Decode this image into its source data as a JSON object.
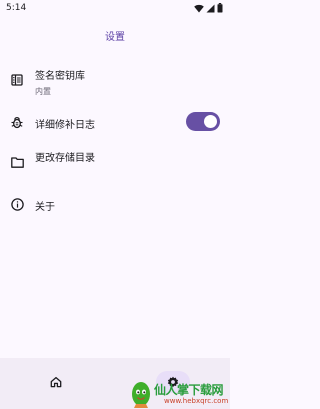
{
  "status_bar": {
    "time": "5:14"
  },
  "header": {
    "title": "设置"
  },
  "settings": {
    "keystore": {
      "title": "签名密钥库",
      "subtitle": "内置"
    },
    "verbose_log": {
      "title": "详细修补日志",
      "enabled": true
    },
    "storage": {
      "title": "更改存储目录"
    },
    "about": {
      "title": "关于"
    }
  },
  "bottom_nav": {
    "active": "settings",
    "items": [
      "home",
      "settings"
    ]
  },
  "watermark": {
    "text": "仙人掌下载网",
    "url": "www.hebxqrc.com"
  },
  "colors": {
    "accent": "#6750a4",
    "title": "#5b3fa5",
    "background": "#fcf8ff",
    "nav_background": "#f2ecf6",
    "nav_indicator": "#e8def8"
  }
}
